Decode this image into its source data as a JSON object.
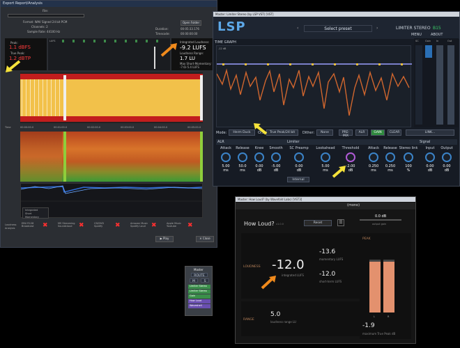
{
  "export": {
    "title": "Export Report/Analysis",
    "file_label": "File:",
    "format": "Format: WAV Signed 24 bit PCM",
    "channels": "Channels: 2",
    "sample_rate": "Sample Rate: 44100 Hz",
    "open_folder": "Open Folder",
    "duration_label": "Duration:",
    "duration_value": "00:05:33.176",
    "timecode_label": "Timecode:",
    "timecode_value": "00:00:00:00",
    "peak_label": "Peak:",
    "peak_value": "1.1 dBFS",
    "true_peak_label": "True Peak:",
    "true_peak_value": "1.2 dBTP",
    "lufs_label": "LUFS",
    "integrated_label": "Integrated Loudness:",
    "integrated_value": "-9.2 LUFS",
    "range_label": "Loudness Range:",
    "range_value": "1.7 LU",
    "max_st_label": "Max Short-Momentary:",
    "max_st_value": "-7.6/-5.4 LUFS",
    "time_label": "Time",
    "time_ticks": [
      "00:00:00.0",
      "00:01:00.0",
      "00:02:00.0",
      "00:03:00.0",
      "00:04:00.0",
      "00:05:00.0"
    ],
    "legend": [
      "Integrated",
      "Short",
      "Momentary"
    ],
    "streaming": [
      {
        "name": "EBU R128",
        "sub": "Broadcast"
      },
      {
        "name": "MS Streaming",
        "sub": "Soundcloud"
      },
      {
        "name": "CD/DVD",
        "sub": "Spotify"
      },
      {
        "name": "Amazon Music",
        "sub": "Spotify Loud"
      },
      {
        "name": "Apple Music",
        "sub": "Youtube"
      }
    ],
    "loudness_label": "Loudness",
    "analysis_label": "Analysis",
    "play_label": "Play",
    "close_label": "Close"
  },
  "lsp": {
    "title": "Master: Limiter Stereo (by LSP VST) [VST]",
    "logo": "LSP",
    "preset": "Select preset",
    "product": "LIMITER STEREO",
    "bypass": "B15",
    "menu": "MENU",
    "about": "ABOUT",
    "time_graph": "TIME GRAPH",
    "db_label": "-12 dB",
    "meter_heads": [
      "SC",
      "Gain",
      "In",
      "Out"
    ],
    "mode_label": "Mode:",
    "mode_value": "Herm Duck",
    "os_label": "O/S:",
    "os_value": "True Peak/24 bit",
    "dither_label": "Dither:",
    "dither_value": "None",
    "pre_mix": "PRE-MIX",
    "alr_btn": "ALR",
    "gain_btn": "GAIN",
    "clear_btn": "CLEAR",
    "link_btn": "LINK...",
    "alr_head": "ALR",
    "limiter_head": "Limiter",
    "signal_head": "Signal",
    "knobs": [
      {
        "label": "Attack",
        "value": "5.00",
        "unit": "ms"
      },
      {
        "label": "Release",
        "value": "50.0",
        "unit": "ms"
      },
      {
        "label": "Knee",
        "value": "0.00",
        "unit": "dB"
      },
      {
        "label": "Smooth",
        "value": "-5.00",
        "unit": "dB"
      },
      {
        "label": "SC Preamp",
        "value": "0.00",
        "unit": "dB"
      },
      {
        "label": "Lookahead",
        "value": "5.00",
        "unit": "ms"
      },
      {
        "label": "Threshold",
        "value": "-2.00",
        "unit": "dB"
      },
      {
        "label": "Attack",
        "value": "0.250",
        "unit": "ms"
      },
      {
        "label": "Release",
        "value": "0.250",
        "unit": "ms"
      },
      {
        "label": "Stereo link",
        "value": "100",
        "unit": "%"
      },
      {
        "label": "Input",
        "value": "0.00",
        "unit": "dB"
      },
      {
        "label": "Output",
        "value": "0.00",
        "unit": "dB"
      }
    ],
    "internal": "Internal"
  },
  "howloud": {
    "title": "Master: How Loud? (by Wavefold Labs) [VST3]",
    "app_title": "How Loud?",
    "version": "v1.0.0",
    "preset_btn": "Reset",
    "output_gain_value": "0.0 dB",
    "output_gain_label": "output gain",
    "loudness_section": "LOUDNESS",
    "integrated_value": "-12.0",
    "integrated_label": "integrated LUFS",
    "momentary_value": "-13.6",
    "momentary_label": "momentary LUFS",
    "short_value": "-12.0",
    "short_label": "short-term LUFS",
    "range_section": "RANGE",
    "range_value": "5.0",
    "range_label": "loudness range LU",
    "peak_section": "PEAK",
    "peak_value": "-1.9",
    "peak_label": "maximum True Peak dB",
    "mono": "(mono)",
    "channels": [
      "L",
      "R"
    ]
  },
  "mixer": {
    "title": "Master",
    "routing": "ROUTE",
    "buttons": [
      "M",
      "S"
    ],
    "fx": [
      "Limiter Stereo",
      "Limiter Stereo",
      "Gain",
      "How Loud",
      "Waveshell"
    ]
  },
  "colors": {
    "arrow": "#f5e23a",
    "arrow2": "#f08a1c",
    "red": "#ff3b3b",
    "orange": "#e8662a",
    "lsp_accent": "#3b83c7"
  }
}
